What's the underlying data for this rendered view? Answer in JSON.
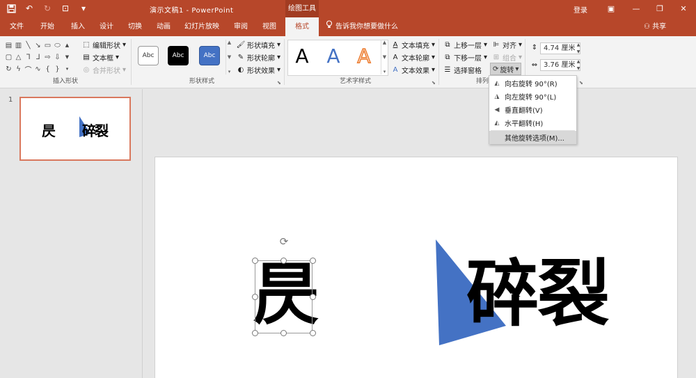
{
  "titlebar": {
    "doc_title": "演示文稿1  -  PowerPoint",
    "tools_label": "绘图工具",
    "login": "登录"
  },
  "tabs": [
    {
      "label": "文件"
    },
    {
      "label": "开始"
    },
    {
      "label": "插入"
    },
    {
      "label": "设计"
    },
    {
      "label": "切换"
    },
    {
      "label": "动画"
    },
    {
      "label": "幻灯片放映"
    },
    {
      "label": "审阅"
    },
    {
      "label": "视图"
    },
    {
      "label": "格式"
    }
  ],
  "tellme": "告诉我你想要做什么",
  "share": "共享",
  "ribbon": {
    "insert_shapes": {
      "label": "插入形状",
      "edit_shape": "编辑形状",
      "textbox": "文本框",
      "merge_shapes": "合并形状"
    },
    "shape_styles": {
      "label": "形状样式",
      "swatch_text": "Abc",
      "fill": "形状填充",
      "outline": "形状轮廓",
      "effects": "形状效果"
    },
    "wordart_styles": {
      "label": "艺术字样式",
      "letter": "A",
      "text_fill": "文本填充",
      "text_outline": "文本轮廓",
      "text_effects": "文本效果"
    },
    "arrange": {
      "label": "排列",
      "bring_forward": "上移一层",
      "send_backward": "下移一层",
      "selection_pane": "选择窗格",
      "align": "对齐",
      "group": "组合",
      "rotate": "旋转"
    },
    "size": {
      "height": "4.74 厘米",
      "width": "3.76 厘米"
    }
  },
  "rotate_menu": [
    {
      "label": "向右旋转 90°(R)"
    },
    {
      "label": "向左旋转 90°(L)"
    },
    {
      "label": "垂直翻转(V)"
    },
    {
      "label": "水平翻转(H)"
    },
    {
      "label": "其他旋转选项(M)..."
    }
  ],
  "thumbnail": {
    "slide_number": "1"
  },
  "slide": {
    "left_text": "昃",
    "right_text": "碎裂"
  },
  "colors": {
    "accent": "#b7472a",
    "shape_blue": "#4472c4"
  }
}
